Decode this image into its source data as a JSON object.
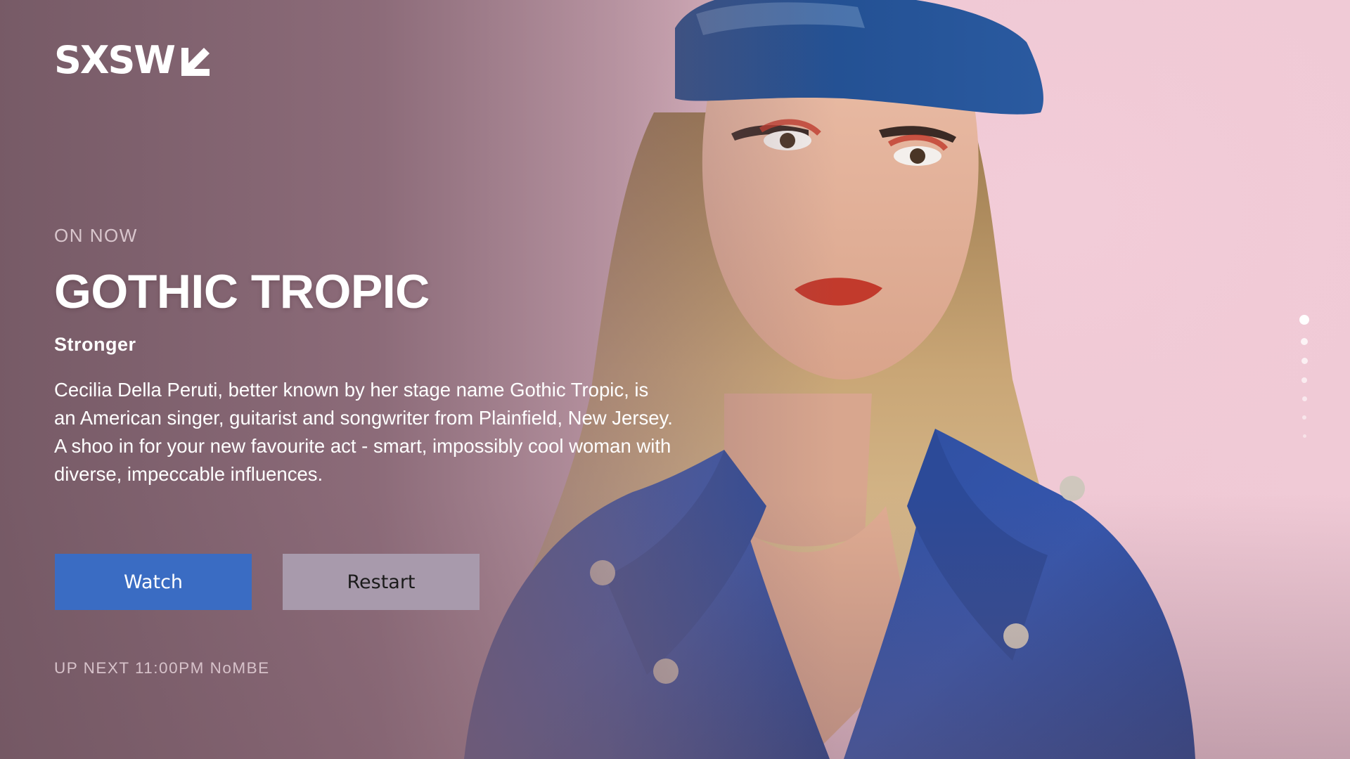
{
  "brand": {
    "logo_text": "SXSW",
    "logo_icon": "arrow-down-left-icon"
  },
  "hero": {
    "eyebrow": "ON NOW",
    "title": "GOTHIC TROPIC",
    "subtitle": "Stronger",
    "description": "Cecilia Della Peruti, better known by her stage name Gothic Tropic, is an American singer, guitarist and songwriter from Plainfield, New Jersey.  A shoo in for your new favourite act - smart, impossibly cool woman with diverse, impeccable influences.",
    "background_image": "portrait of artist in blue cap and blue suede jacket against pink wall"
  },
  "actions": {
    "watch_label": "Watch",
    "restart_label": "Restart"
  },
  "up_next": "UP NEXT 11:00PM NoMBE",
  "pagination": {
    "total": 7,
    "active": 0
  },
  "colors": {
    "watch_button": "#3a6cc3",
    "restart_button": "#a89aac",
    "background": "#e9c3cf"
  }
}
